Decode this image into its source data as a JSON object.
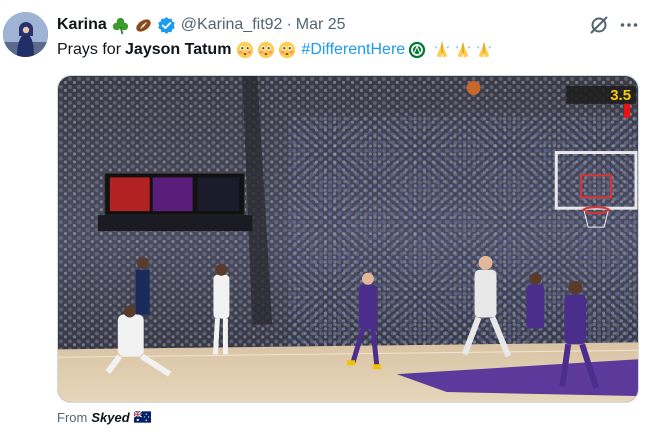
{
  "tweet": {
    "author": {
      "name": "Karina",
      "handle": "@Karina_fit92",
      "emojis": [
        "shamrock-emoji",
        "football-emoji"
      ],
      "verified": true
    },
    "separator": "·",
    "date": "Mar 25",
    "text": {
      "prefix": "Prays for",
      "bold": "Jayson Tatum",
      "hashtag": "#DifferentHere"
    },
    "scoreboard_clock": "3.5",
    "from": {
      "label": "From",
      "source": "Skyed"
    }
  },
  "colors": {
    "link": "#1d9bf0",
    "secondary_text": "#536471",
    "verified_badge": "#1d9bf0",
    "court_purple": "#5b3a9c"
  },
  "icons": [
    "grok-icon",
    "more-options-icon",
    "verified-badge-icon",
    "australia-flag-icon"
  ]
}
